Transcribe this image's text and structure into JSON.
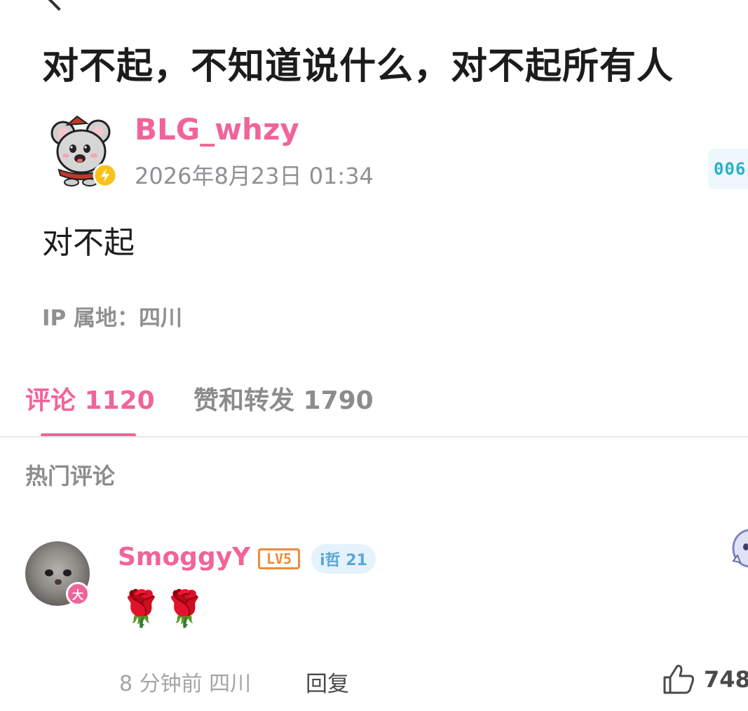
{
  "post": {
    "title": "对不起，不知道说什么，对不起所有人",
    "author": "BLG_whzy",
    "time": "2026年8月23日 01:34",
    "fan_badge_text": "006",
    "body": "对不起",
    "ip_location": "IP 属地：四川"
  },
  "tabs": {
    "comments": "评论 1120",
    "reposts": "赞和转发 1790"
  },
  "section": {
    "hot_comments_label": "热门评论"
  },
  "comment": {
    "username": "SmoggyY",
    "level": "LV5",
    "medal": "i哲 21",
    "verified_badge": "大",
    "text": "🌹🌹",
    "meta": "8 分钟前 四川",
    "reply_label": "回复",
    "like_count": "748"
  },
  "colors": {
    "accent_pink": "#f0649a",
    "level_orange": "#f08a3a",
    "medal_blue": "#5aa7d6",
    "muted_gray": "#8c8c8c"
  },
  "icons": [
    "back-arrow-icon",
    "lightning-icon",
    "thumbs-up-icon"
  ]
}
